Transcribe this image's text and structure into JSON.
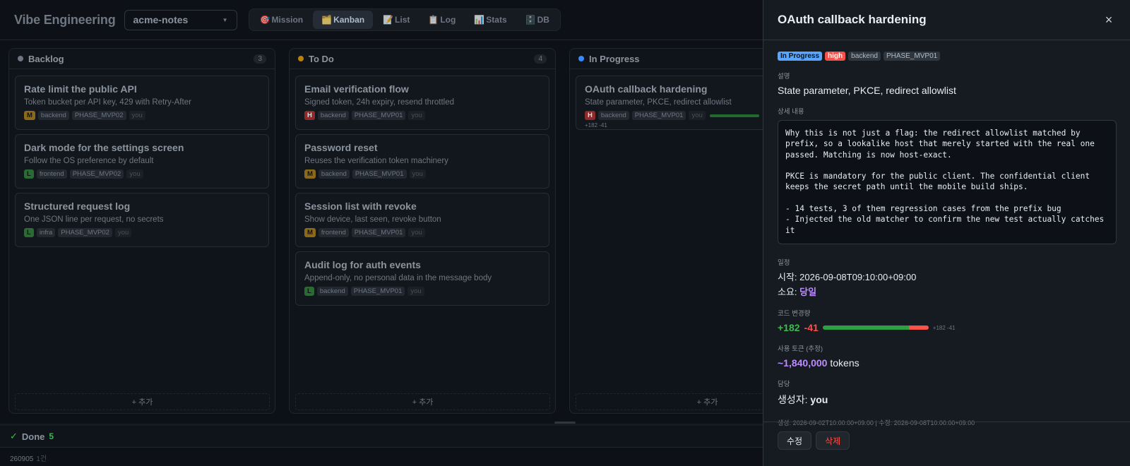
{
  "header": {
    "brand": "Vibe Engineering",
    "project": "acme-notes",
    "tabs": [
      {
        "icon": "🎯",
        "label": "Mission"
      },
      {
        "icon": "🗂️",
        "label": "Kanban"
      },
      {
        "icon": "📝",
        "label": "List"
      },
      {
        "icon": "📋",
        "label": "Log"
      },
      {
        "icon": "📊",
        "label": "Stats"
      },
      {
        "icon": "🗄️",
        "label": "DB"
      }
    ]
  },
  "colors": {
    "backlog": "#6e7681",
    "todo": "#bb8009",
    "inprogress": "#388bfd",
    "done": "#3fb950"
  },
  "columns": {
    "backlog": {
      "title": "Backlog",
      "count": "3",
      "add": "+ 추가",
      "cards": [
        {
          "title": "Rate limit the public API",
          "desc": "Token bucket per API key, 429 with Retry-After",
          "priority": "M",
          "tag": "backend",
          "phase": "PHASE_MVP02",
          "user": "you"
        },
        {
          "title": "Dark mode for the settings screen",
          "desc": "Follow the OS preference by default",
          "priority": "L",
          "tag": "frontend",
          "phase": "PHASE_MVP02",
          "user": "you"
        },
        {
          "title": "Structured request log",
          "desc": "One JSON line per request, no secrets",
          "priority": "L",
          "tag": "infra",
          "phase": "PHASE_MVP02",
          "user": "you"
        }
      ]
    },
    "todo": {
      "title": "To Do",
      "count": "4",
      "add": "+ 추가",
      "cards": [
        {
          "title": "Email verification flow",
          "desc": "Signed token, 24h expiry, resend throttled",
          "priority": "H",
          "tag": "backend",
          "phase": "PHASE_MVP01",
          "user": "you"
        },
        {
          "title": "Password reset",
          "desc": "Reuses the verification token machinery",
          "priority": "M",
          "tag": "backend",
          "phase": "PHASE_MVP01",
          "user": "you"
        },
        {
          "title": "Session list with revoke",
          "desc": "Show device, last seen, revoke button",
          "priority": "M",
          "tag": "frontend",
          "phase": "PHASE_MVP01",
          "user": "you"
        },
        {
          "title": "Audit log for auth events",
          "desc": "Append-only, no personal data in the message body",
          "priority": "L",
          "tag": "backend",
          "phase": "PHASE_MVP01",
          "user": "you"
        }
      ]
    },
    "inprogress": {
      "title": "In Progress",
      "add": "+ 추가",
      "cards": [
        {
          "title": "OAuth callback hardening",
          "desc": "State parameter, PKCE, redirect allowlist",
          "priority": "H",
          "tag": "backend",
          "phase": "PHASE_MVP01",
          "user": "you",
          "diff": "+182 -41"
        }
      ]
    }
  },
  "done": {
    "label": "Done",
    "count": "5",
    "group": "260905",
    "group_count": "1건"
  },
  "detail": {
    "title": "OAuth callback hardening",
    "status": "In Progress",
    "priority": "high",
    "tag": "backend",
    "phase": "PHASE_MVP01",
    "desc_label": "설명",
    "desc": "State parameter, PKCE, redirect allowlist",
    "detail_label": "상세 내용",
    "detail_text": "Why this is not just a flag: the redirect allowlist matched by prefix, so a lookalike host that merely started with the real one passed. Matching is now host-exact.\n\nPKCE is mandatory for the public client. The confidential client keeps the secret path until the mobile build ships.\n\n- 14 tests, 3 of them regression cases from the prefix bug\n- Injected the old matcher to confirm the new test actually catches it",
    "schedule_label": "일정",
    "start_prefix": "시작: ",
    "start": "2026-09-08T09:10:00+09:00",
    "duration_prefix": "소요: ",
    "duration": "당일",
    "code_label": "코드 변경량",
    "additions": "+182",
    "deletions": "-41",
    "additions_count": 182,
    "deletions_count": 41,
    "diff_mini": "+182 -41",
    "tokens_label": "사용 토큰 (추정)",
    "tokens": "~1,840,000",
    "tokens_unit": " tokens",
    "owner_label": "담당",
    "owner_prefix": "생성자: ",
    "owner": "you",
    "timestamps": "생성: 2026-09-02T10:00:00+09:00 | 수정: 2026-09-08T10:00:00+09:00",
    "edit": "수정",
    "delete": "삭제"
  }
}
